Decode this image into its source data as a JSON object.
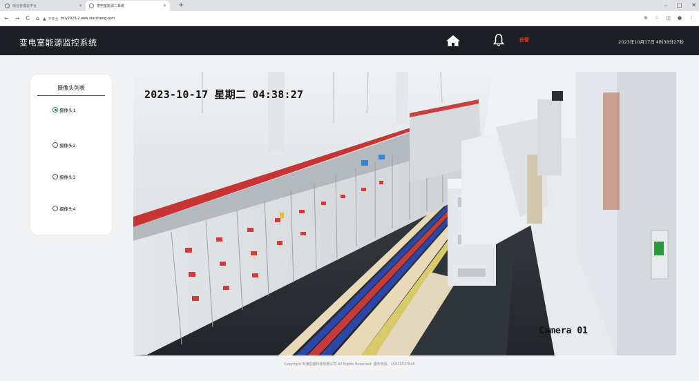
{
  "browser": {
    "tabs": [
      {
        "title": "综合管理云平台",
        "active": false
      },
      {
        "title": "变电室能源二系统",
        "active": true
      }
    ],
    "new_tab": "+",
    "nav": {
      "back": "←",
      "forward": "→",
      "reload": "C",
      "home": "⌂"
    },
    "security_label": "不安全",
    "url": "znly2023-2.web.starsheng.com",
    "window_controls": {
      "minimize": "–",
      "maximize": "□",
      "close": "✕"
    }
  },
  "header": {
    "title": "变电室能源监控系统",
    "alarm_text": "报警",
    "datetime": "2023年10月17日 4时38分27秒",
    "colors": {
      "background": "#1c1f24",
      "alarm": "#e0281e"
    }
  },
  "camera_list": {
    "title": "摄像头列表",
    "items": [
      {
        "label": "摄像头1",
        "selected": true
      },
      {
        "label": "摄像头2",
        "selected": false
      },
      {
        "label": "摄像头3",
        "selected": false
      },
      {
        "label": "摄像头4",
        "selected": false
      }
    ]
  },
  "video": {
    "timestamp": "2023-10-17 星期二 04:38:27",
    "camera_label": "Camera 01"
  },
  "footer": {
    "text": "Copyright 天津星盛科技有限公司 All Rights Reserved.    服务电话：15022037816"
  }
}
